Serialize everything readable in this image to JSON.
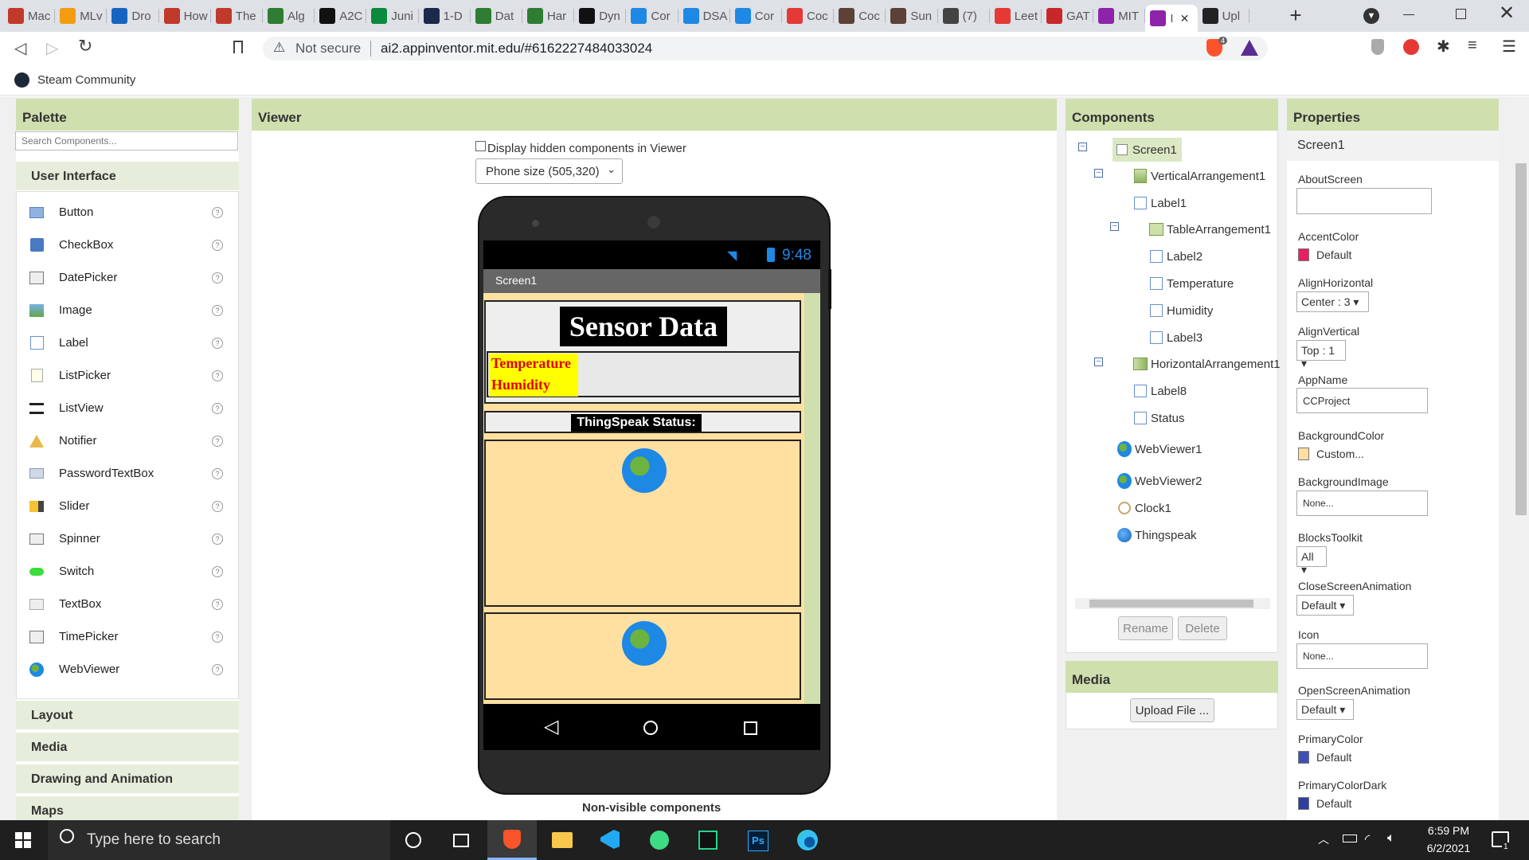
{
  "browser": {
    "tabs": [
      {
        "label": "Mac",
        "color": "#c0392b",
        "icon": "app-inventor-icon"
      },
      {
        "label": "MLv",
        "color": "#f39c12",
        "icon": "coursera-icon"
      },
      {
        "label": "Dro",
        "color": "#1565c0",
        "icon": "dropbox-icon"
      },
      {
        "label": "How",
        "color": "#c0392b",
        "icon": "wiki-icon"
      },
      {
        "label": "The",
        "color": "#c0392b",
        "icon": "app-inventor-icon"
      },
      {
        "label": "Alg",
        "color": "#2e7d32",
        "icon": "geeks-icon"
      },
      {
        "label": "A2C",
        "color": "#111111",
        "icon": "a2-icon"
      },
      {
        "label": "Juni",
        "color": "#0a8a3a",
        "icon": "plus-icon"
      },
      {
        "label": "1-D",
        "color": "#1a2a4a",
        "icon": "h-icon"
      },
      {
        "label": "Dat",
        "color": "#2e7d32",
        "icon": "geeks-icon"
      },
      {
        "label": "Har",
        "color": "#2e7d32",
        "icon": "geeks-icon"
      },
      {
        "label": "Dyn",
        "color": "#111111",
        "icon": "hr-icon"
      },
      {
        "label": "Cor",
        "color": "#1e88e5",
        "icon": "cup-icon"
      },
      {
        "label": "DSA",
        "color": "#1e88e5",
        "icon": "cup-icon"
      },
      {
        "label": "Cor",
        "color": "#1e88e5",
        "icon": "cup-icon"
      },
      {
        "label": "Coc",
        "color": "#e53935",
        "icon": "bar-icon"
      },
      {
        "label": "Coc",
        "color": "#5d4037",
        "icon": "cc-icon"
      },
      {
        "label": "Sun",
        "color": "#5d4037",
        "icon": "cc-icon"
      },
      {
        "label": "(7)",
        "color": "#444444",
        "icon": "spiral-icon"
      },
      {
        "label": "Leet",
        "color": "#e53935",
        "icon": "youtube-icon"
      },
      {
        "label": "GAT",
        "color": "#c62828",
        "icon": "gate-icon"
      },
      {
        "label": "MIT",
        "color": "#8e24aa",
        "icon": "mit-icon"
      },
      {
        "label": "I",
        "color": "#8e24aa",
        "icon": "mit-icon"
      },
      {
        "label": "Upl",
        "color": "#222222",
        "icon": "github-icon"
      }
    ],
    "url_warning": "Not secure",
    "url": "ai2.appinventor.mit.edu/#6162227484033024",
    "bookmark": "Steam Community",
    "brave_count": "4"
  },
  "palette": {
    "title": "Palette",
    "search_placeholder": "Search Components...",
    "category": "User Interface",
    "items": [
      "Button",
      "CheckBox",
      "DatePicker",
      "Image",
      "Label",
      "ListPicker",
      "ListView",
      "Notifier",
      "PasswordTextBox",
      "Slider",
      "Spinner",
      "Switch",
      "TextBox",
      "TimePicker",
      "WebViewer"
    ],
    "help": "?",
    "other_categories": [
      "Layout",
      "Media",
      "Drawing and Animation",
      "Maps"
    ]
  },
  "viewer": {
    "title": "Viewer",
    "hidden_checkbox_label": "Display hidden components in Viewer",
    "size_select": "Phone size (505,320)",
    "time": "9:48",
    "screen_title": "Screen1",
    "sensor_title": "Sensor Data",
    "temperature": "Temperature",
    "humidity": "Humidity",
    "status_label": "ThingSpeak Status:",
    "nonvisible": "Non-visible components"
  },
  "components": {
    "title": "Components",
    "tree": [
      {
        "label": "Screen1",
        "icon": "screen-icon"
      },
      {
        "label": "VerticalArrangement1",
        "icon": "vertical-arrangement-icon"
      },
      {
        "label": "Label1",
        "icon": "label-icon"
      },
      {
        "label": "TableArrangement1",
        "icon": "table-arrangement-icon"
      },
      {
        "label": "Label2",
        "icon": "label-icon"
      },
      {
        "label": "Temperature",
        "icon": "label-icon"
      },
      {
        "label": "Humidity",
        "icon": "label-icon"
      },
      {
        "label": "Label3",
        "icon": "label-icon"
      },
      {
        "label": "HorizontalArrangement1",
        "icon": "horizontal-arrangement-icon"
      },
      {
        "label": "Label8",
        "icon": "label-icon"
      },
      {
        "label": "Status",
        "icon": "label-icon"
      },
      {
        "label": "WebViewer1",
        "icon": "webviewer-icon"
      },
      {
        "label": "WebViewer2",
        "icon": "webviewer-icon"
      },
      {
        "label": "Clock1",
        "icon": "clock-icon"
      },
      {
        "label": "Thingspeak",
        "icon": "web-icon"
      }
    ],
    "rename": "Rename",
    "delete": "Delete",
    "media_title": "Media",
    "upload": "Upload File ..."
  },
  "properties": {
    "title": "Properties",
    "component": "Screen1",
    "about_label": "AboutScreen",
    "accent_label": "AccentColor",
    "accent_value": "Default",
    "accent_color": "#e91e63",
    "alignh_label": "AlignHorizontal",
    "alignh_value": "Center : 3",
    "alignv_label": "AlignVertical",
    "alignv_value": "Top : 1",
    "appname_label": "AppName",
    "appname_value": "CCProject",
    "bgcolor_label": "BackgroundColor",
    "bgcolor_value": "Custom...",
    "bgcolor_color": "#ffe0a0",
    "bgimage_label": "BackgroundImage",
    "bgimage_value": "None...",
    "blocks_label": "BlocksToolkit",
    "blocks_value": "All",
    "closeanim_label": "CloseScreenAnimation",
    "closeanim_value": "Default",
    "icon_label": "Icon",
    "icon_value": "None...",
    "openanim_label": "OpenScreenAnimation",
    "openanim_value": "Default",
    "primary_label": "PrimaryColor",
    "primary_value": "Default",
    "primary_color": "#3f51b5",
    "primarydark_label": "PrimaryColorDark",
    "primarydark_value": "Default",
    "primarydark_color": "#303f9f"
  },
  "taskbar": {
    "search_placeholder": "Type here to search",
    "time": "6:59 PM",
    "date": "6/2/2021",
    "notifications": "1"
  }
}
